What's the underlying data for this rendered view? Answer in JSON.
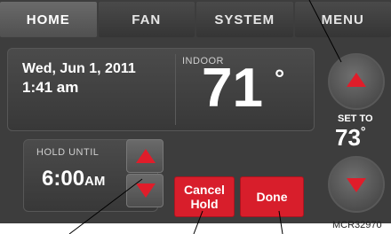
{
  "tabs": [
    {
      "label": "HOME",
      "active": true
    },
    {
      "label": "FAN",
      "active": false
    },
    {
      "label": "SYSTEM",
      "active": false
    },
    {
      "label": "MENU",
      "active": false
    }
  ],
  "info": {
    "date": "Wed, Jun 1, 2011",
    "time": "1:41 am",
    "indoor_label": "INDOOR",
    "indoor_temp": "71",
    "indoor_unit": "°"
  },
  "hold": {
    "label": "HOLD UNTIL",
    "time": "6:00",
    "ampm": "AM"
  },
  "buttons": {
    "cancel_line1": "Cancel",
    "cancel_line2": "Hold",
    "done": "Done"
  },
  "setpoint": {
    "label": "SET TO",
    "value": "73",
    "unit": "°"
  },
  "figure_code": "MCR32970",
  "colors": {
    "accent": "#d81e2b",
    "panel": "#3d3d3d"
  }
}
